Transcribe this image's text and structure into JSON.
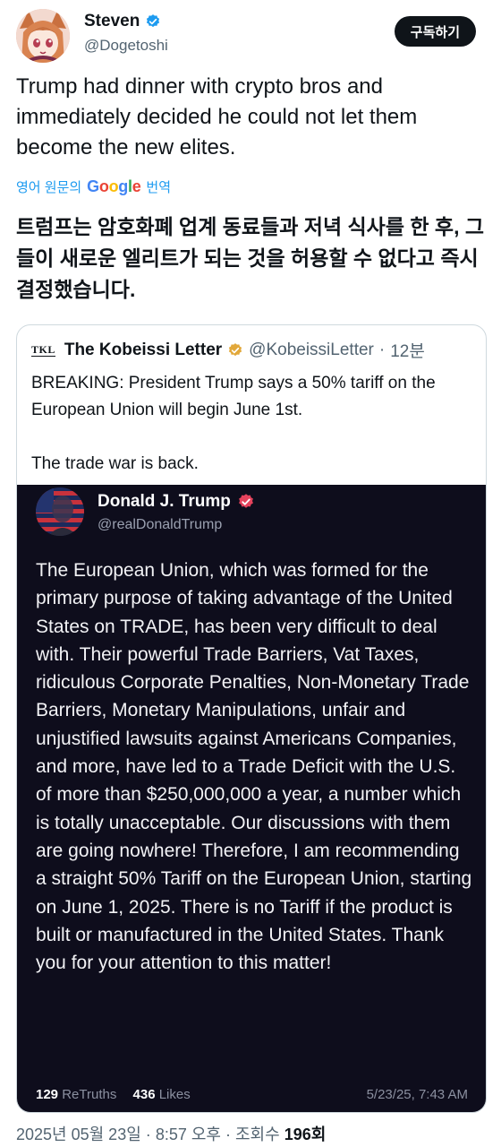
{
  "author": {
    "display_name": "Steven",
    "handle": "@Dogetoshi",
    "avatar_icon": "anime-fox-girl-avatar",
    "verified_color": "#1d9bf0"
  },
  "subscribe_label": "구독하기",
  "tweet": {
    "text": "Trump had dinner with crypto bros and immediately decided he could not let them become the new elites.",
    "translate_prefix": "영어 원문의",
    "translate_brand": "Google",
    "translate_suffix": "번역",
    "translated_text": "트럼프는 암호화폐 업계 동료들과 저녁 식사를 한 후, 그들이 새로운 엘리트가 되는 것을 허용할 수 없다고 즉시 결정했습니다."
  },
  "quote": {
    "logo_text": "TKL",
    "name": "The Kobeissi Letter",
    "handle": "@KobeissiLetter",
    "separator": "·",
    "time": "12분",
    "line1": "BREAKING: President Trump says a 50% tariff on the European Union will begin June 1st.",
    "line2": "The trade war is back.",
    "verified_color": "#e2a83a"
  },
  "truth": {
    "name": "Donald J. Trump",
    "handle": "@realDonaldTrump",
    "verified_color": "#e5425c",
    "avatar_icon": "trump-flag-avatar",
    "body": "The European Union, which was formed for the primary purpose of taking advantage of the United States on TRADE, has been very difficult to deal with. Their powerful Trade Barriers, Vat Taxes, ridiculous Corporate Penalties, Non-Monetary Trade Barriers, Monetary Manipulations, unfair and unjustified lawsuits against Americans Companies, and more, have led to a Trade Deficit with the U.S. of more than $250,000,000 a year, a number which is totally unacceptable. Our discussions with them are going nowhere! Therefore, I am recommending a straight 50% Tariff on the European Union, starting on June 1, 2025. There is no Tariff if the product is built or manufactured in the United States. Thank you for your attention to this matter!",
    "retruths_count": "129",
    "retruths_label": "ReTruths",
    "likes_count": "436",
    "likes_label": "Likes",
    "timestamp": "5/23/25, 7:43 AM"
  },
  "meta": {
    "date": "2025년 05월 23일",
    "sep1": "·",
    "time": "8:57 오후",
    "sep2": "·",
    "views_label": "조회수",
    "views_count": "196회"
  }
}
